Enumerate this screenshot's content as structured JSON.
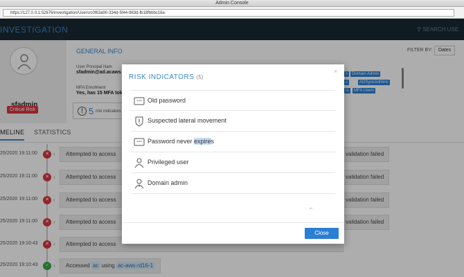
{
  "window": {
    "title": "Admin Console"
  },
  "browser": {
    "url": "https://127.0.0.1:52676/investigation/Users/c0f63a90-334d-5f44-983d-fb18fbbbc16a"
  },
  "header": {
    "title": "INVESTIGATION",
    "search_placeholder": "SEARCH USE"
  },
  "profile": {
    "name": "sfadmin",
    "org": "Silverfort",
    "risk_badge": "Critical Risk"
  },
  "general_info": {
    "title": "GENERAL INFO",
    "upn_label": "User Principal Nam",
    "upn_value": "sfadmin@ad.acaws",
    "mfa_label": "MFA Enrollment",
    "mfa_value": "Yes, has 15 MFA tok",
    "risk_count": "5",
    "risk_label": "risk indicators"
  },
  "filter": {
    "label": "FILTER BY:",
    "dates_button": "Dates"
  },
  "groups": [
    "s",
    "Domain Admin",
    "s",
    "ADSyncAdmins",
    "ts",
    "MFA Users"
  ],
  "tabs": [
    {
      "label": "MELINE"
    },
    {
      "label": "STATISTICS"
    }
  ],
  "timeline": [
    {
      "time": "25/2020 19:11:00",
      "status": "fail",
      "text": "Attempted to access",
      "right": "validation failed"
    },
    {
      "time": "25/2020 19:11:00",
      "status": "fail",
      "text": "Attempted to access",
      "right": "validation failed"
    },
    {
      "time": "25/2020 19:11:00",
      "status": "fail",
      "text": "Attempted to access",
      "right": "validation failed"
    },
    {
      "time": "25/2020 19:11:00",
      "status": "fail",
      "text": "Attempted to access",
      "right": "validation failed"
    },
    {
      "time": "25/2020 19:10:43",
      "status": "fail",
      "text": "Attempted to access",
      "right": ""
    },
    {
      "time": "25/2020 19:10:43",
      "status": "ok",
      "text": "Accessed",
      "chip1": "ac",
      "using": "using",
      "chip2": "ac-aws-rd16-1"
    }
  ],
  "modal": {
    "title": "RISK INDICATORS",
    "count": "(5)",
    "close_x": "×",
    "close_button": "Close",
    "items": [
      {
        "icon": "password-icon",
        "label": "Old password"
      },
      {
        "icon": "alert-shield-icon",
        "label": "Suspected lateral movement"
      },
      {
        "icon": "password-icon",
        "label_before": "Password never ",
        "label_highlight": "expire",
        "label_after": "s"
      },
      {
        "icon": "user-icon",
        "label": "Privileged user"
      },
      {
        "icon": "admin-user-icon",
        "label": "Domain admin"
      }
    ]
  }
}
